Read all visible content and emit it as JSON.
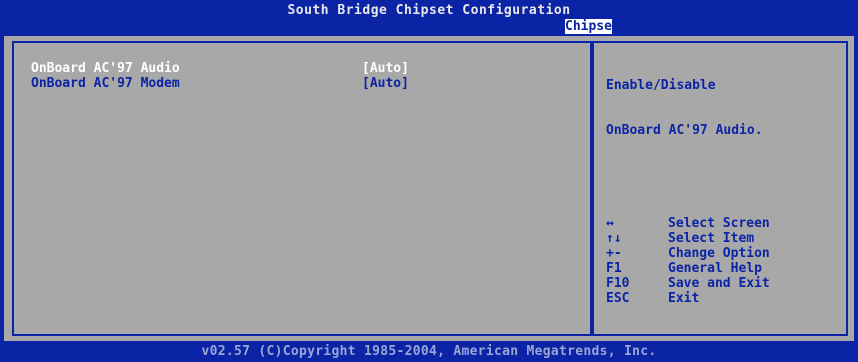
{
  "header": {
    "title": "South Bridge Chipset Configuration",
    "tab": "Chipset"
  },
  "settings": [
    {
      "label": "OnBoard AC'97 Audio",
      "value": "[Auto]",
      "selected": true
    },
    {
      "label": "OnBoard AC'97 Modem",
      "value": "[Auto]",
      "selected": false
    }
  ],
  "help": {
    "line1": "Enable/Disable",
    "line2": "OnBoard AC'97 Audio."
  },
  "keys": [
    {
      "key": "↔",
      "action": "Select Screen",
      "icon": "left-right-arrow-icon"
    },
    {
      "key": "↑↓",
      "action": "Select Item",
      "icon": "up-down-arrow-icon"
    },
    {
      "key": "+-",
      "action": "Change Option",
      "icon": "plus-minus-icon"
    },
    {
      "key": "F1",
      "action": "General Help"
    },
    {
      "key": "F10",
      "action": "Save and Exit"
    },
    {
      "key": "ESC",
      "action": "Exit"
    }
  ],
  "footer": "v02.57 (C)Copyright 1985-2004, American Megatrends, Inc.",
  "colors": {
    "background_blue": "#0b24a6",
    "panel_gray": "#a8a8a8",
    "text_white": "#ffffff"
  }
}
